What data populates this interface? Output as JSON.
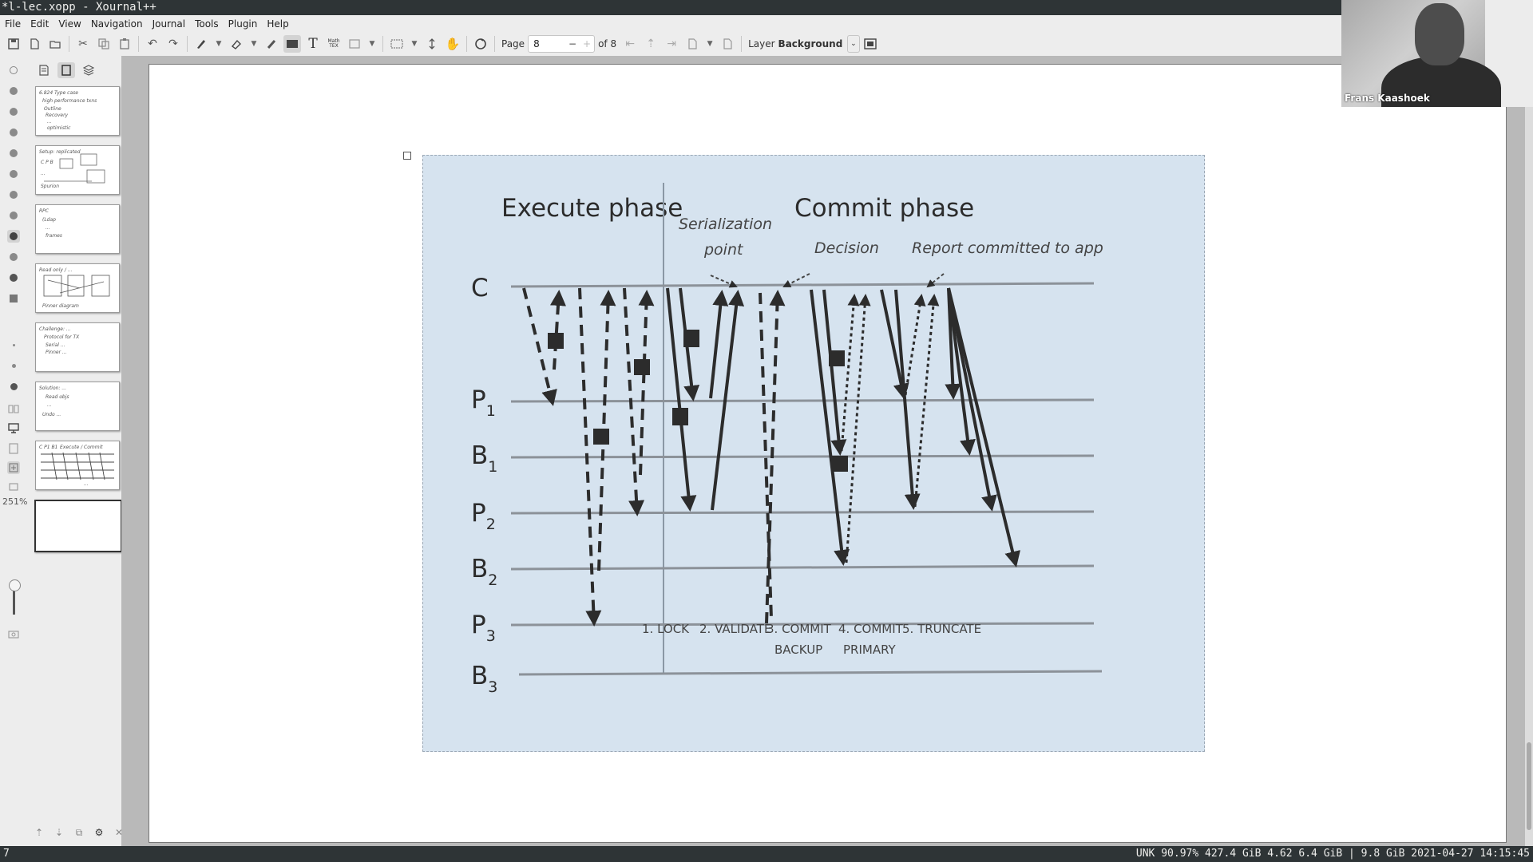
{
  "window": {
    "title": "*l-lec.xopp - Xournal++"
  },
  "menu": [
    "File",
    "Edit",
    "View",
    "Navigation",
    "Journal",
    "Tools",
    "Plugin",
    "Help"
  ],
  "toolbar": {
    "page_label": "Page",
    "page_value": "8",
    "page_minus": "−",
    "page_plus": "+",
    "page_of": "of 8",
    "layer_label": "Layer",
    "layer_value": "Background",
    "math_tex": "Math\nTEX"
  },
  "zoom": {
    "level": "251%"
  },
  "sidebar": {
    "thumbnails": [
      {
        "page": 1,
        "lines": [
          "6.824  Type case",
          "high performance txns",
          "Outline",
          "Recovery",
          "...",
          "optimistic"
        ]
      },
      {
        "page": 2,
        "lines": [
          "Setup: replicated",
          "C   P   B",
          "...",
          "Spurion"
        ]
      },
      {
        "page": 3,
        "lines": [
          "RPC",
          "(Ldap",
          "...",
          "frames"
        ]
      },
      {
        "page": 4,
        "lines": [
          "Read only / ... ",
          "Pinner diagram"
        ]
      },
      {
        "page": 5,
        "lines": [
          "Challenge: ...",
          "Protocol for TX",
          "Serial ...",
          "Pinner ..."
        ]
      },
      {
        "page": 6,
        "lines": [
          "Solution: ...",
          "Read objs",
          "...",
          "Undo ..."
        ]
      },
      {
        "page": 7,
        "lines": [
          "C   P1  B1",
          "Execute / Commit",
          "..."
        ]
      },
      {
        "page": 8,
        "lines": []
      }
    ]
  },
  "figure": {
    "headings": {
      "execute": "Execute phase",
      "commit": "Commit phase"
    },
    "annotations": {
      "serialization": [
        "Serialization",
        "point"
      ],
      "decision": "Decision",
      "report": "Report committed to app"
    },
    "rows": [
      {
        "name": "C",
        "sub": ""
      },
      {
        "name": "P",
        "sub": "1"
      },
      {
        "name": "B",
        "sub": "1"
      },
      {
        "name": "P",
        "sub": "2"
      },
      {
        "name": "B",
        "sub": "2"
      },
      {
        "name": "P",
        "sub": "3"
      },
      {
        "name": "B",
        "sub": "3"
      }
    ],
    "steps": [
      [
        "1. LOCK"
      ],
      [
        "2. VALIDATE"
      ],
      [
        "3. COMMIT",
        "BACKUP"
      ],
      [
        "4. COMMIT",
        "PRIMARY"
      ],
      [
        "5. TRUNCATE"
      ]
    ]
  },
  "webcam": {
    "name": "Frans Kaashoek"
  },
  "status": {
    "left": "7",
    "right": "UNK 90.97% 427.4 GiB 4.62 6.4 GiB | 9.8 GiB 2021-04-27 14:15:45"
  },
  "colors": {
    "figure_bg": "#d6e3ef",
    "ink": "#2c2c2c",
    "chrome": "#ededed",
    "dark_bar": "#2e3436"
  }
}
